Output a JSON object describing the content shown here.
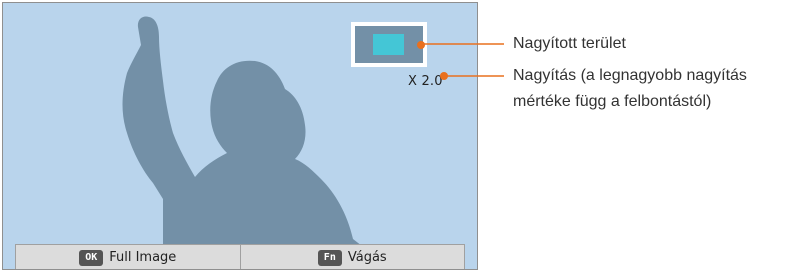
{
  "screen": {
    "zoom_level": "X 2.0"
  },
  "bottom_bar": {
    "ok_key": "OK",
    "ok_label": "Full Image",
    "fn_key": "Fn",
    "fn_label": "Vágás"
  },
  "callouts": {
    "zoomed_area": "Nagyított terület",
    "zoom_line1": "Nagyítás (a legnagyobb nagyítás",
    "zoom_line2": "mértéke függ a felbontástól)"
  },
  "colors": {
    "screen_bg": "#b9d4ec",
    "silhouette": "#7390a7",
    "thumb_area": "#44c6d6",
    "accent_orange": "#e9701e"
  }
}
